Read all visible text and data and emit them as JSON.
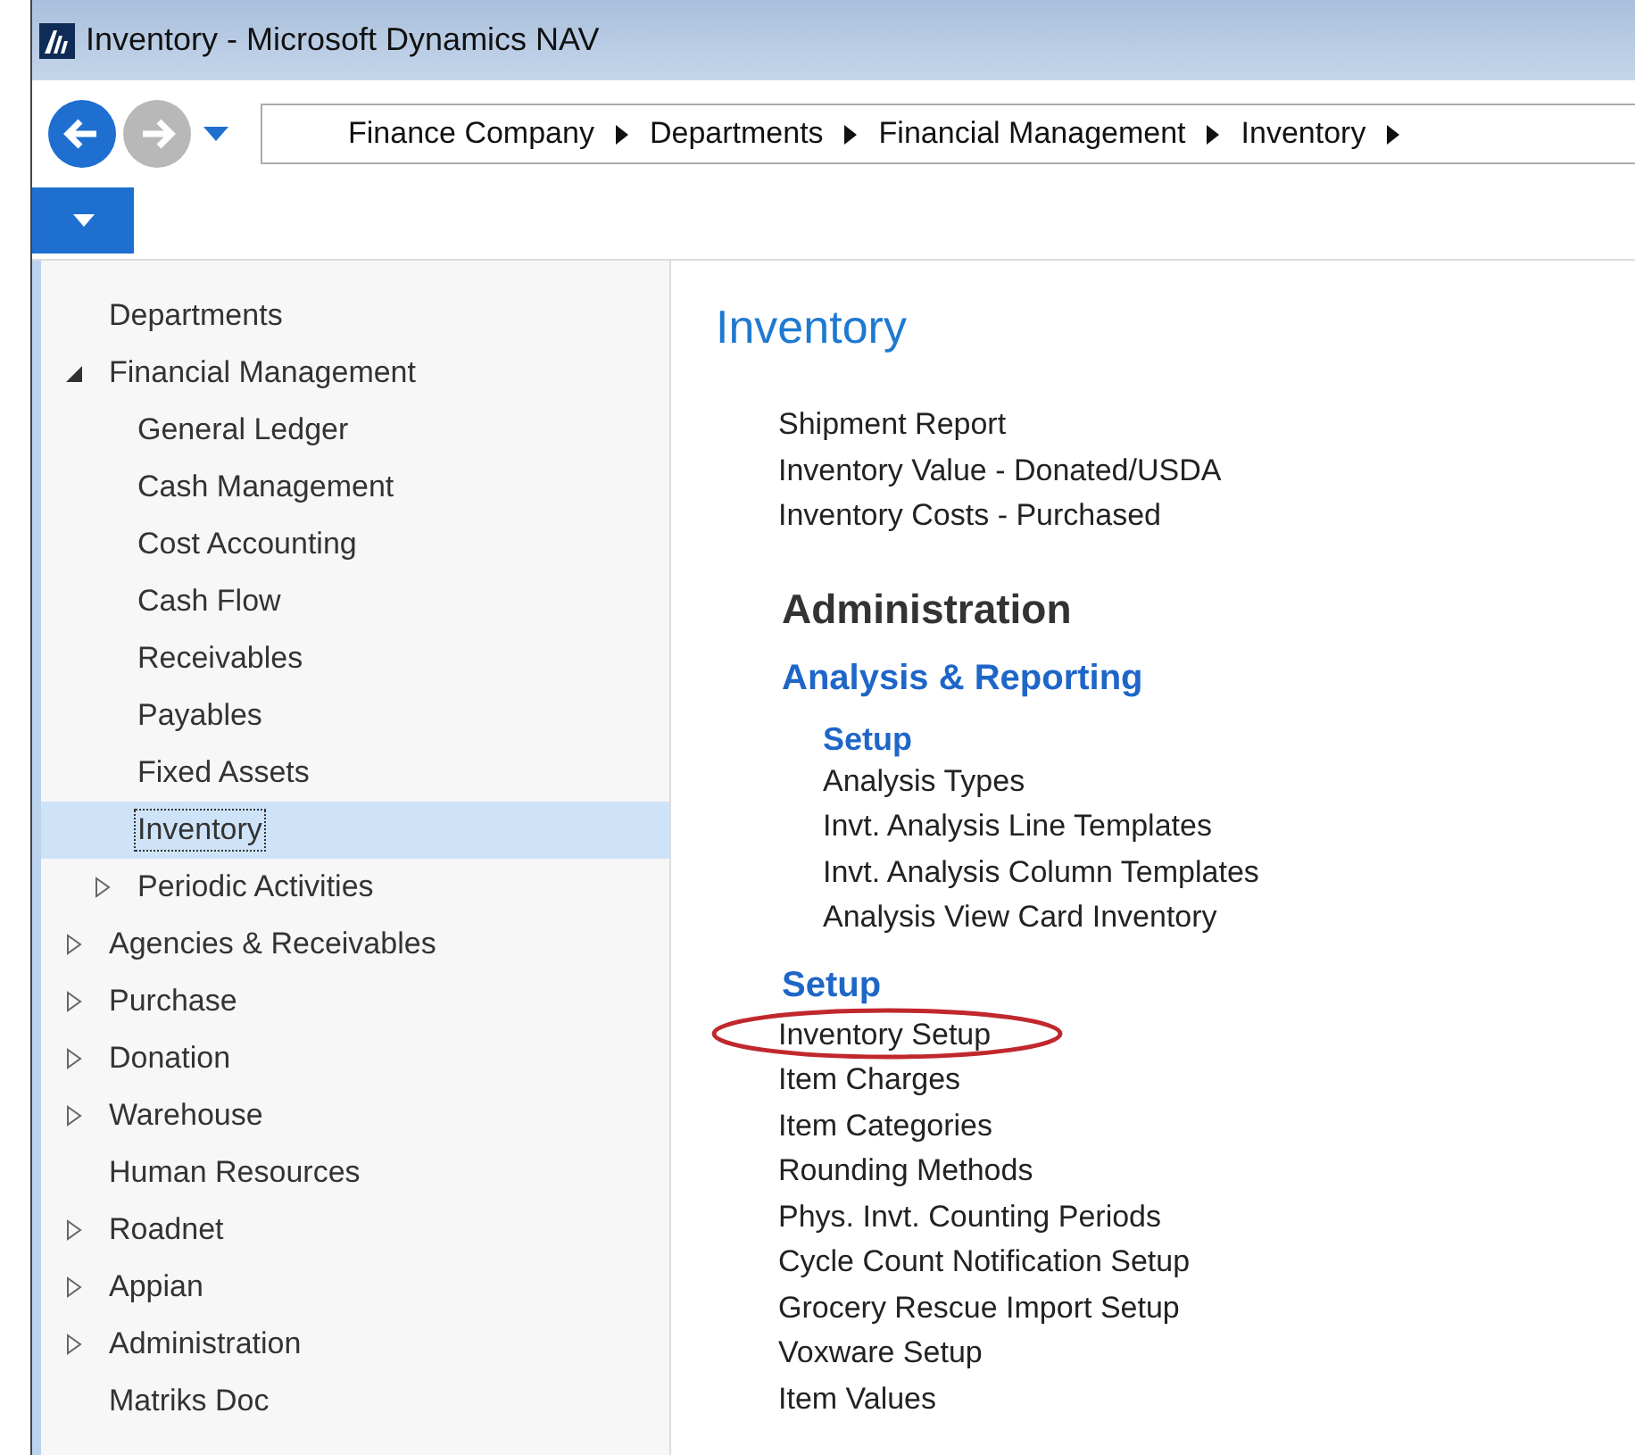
{
  "window": {
    "title": "Inventory - Microsoft Dynamics NAV"
  },
  "navigation": {
    "back_enabled": true,
    "forward_enabled": false,
    "breadcrumb": [
      "Finance Company",
      "Departments",
      "Financial Management",
      "Inventory"
    ]
  },
  "navigation_pane": {
    "items": [
      {
        "label": "Departments",
        "selected": false
      },
      {
        "label": "Financial Management",
        "expanded": true,
        "selected": false,
        "children": [
          {
            "label": "General Ledger",
            "selected": false
          },
          {
            "label": "Cash Management",
            "selected": false
          },
          {
            "label": "Cost Accounting",
            "selected": false
          },
          {
            "label": "Cash Flow",
            "selected": false
          },
          {
            "label": "Receivables",
            "selected": false
          },
          {
            "label": "Payables",
            "selected": false
          },
          {
            "label": "Fixed Assets",
            "selected": false
          },
          {
            "label": "Inventory",
            "selected": true
          },
          {
            "label": "Periodic Activities",
            "expanded": false,
            "selected": false
          }
        ]
      },
      {
        "label": "Agencies & Receivables",
        "expanded": false,
        "selected": false
      },
      {
        "label": "Purchase",
        "expanded": false,
        "selected": false
      },
      {
        "label": "Donation",
        "expanded": false,
        "selected": false
      },
      {
        "label": "Warehouse",
        "expanded": false,
        "selected": false
      },
      {
        "label": "Human Resources",
        "selected": false
      },
      {
        "label": "Roadnet",
        "expanded": false,
        "selected": false
      },
      {
        "label": "Appian",
        "expanded": false,
        "selected": false
      },
      {
        "label": "Administration",
        "expanded": false,
        "selected": false
      },
      {
        "label": "Matriks Doc",
        "selected": false
      }
    ]
  },
  "content": {
    "title": "Inventory",
    "links": [
      "Shipment Report",
      "Inventory Value - Donated/USDA",
      "Inventory Costs - Purchased"
    ],
    "administration": {
      "title": "Administration",
      "groups": [
        {
          "title": "Analysis & Reporting",
          "subgroups": [
            {
              "title": "Setup",
              "links": [
                "Analysis Types",
                "Invt. Analysis Line Templates",
                "Invt. Analysis Column Templates",
                "Analysis View Card Inventory"
              ]
            }
          ]
        },
        {
          "title": "Setup",
          "links": [
            {
              "text": "Inventory Setup",
              "circled": true
            },
            {
              "text": "Item Charges",
              "circled": false
            },
            {
              "text": "Item Categories",
              "circled": false
            },
            {
              "text": "Rounding Methods",
              "circled": false
            },
            {
              "text": "Phys. Invt. Counting Periods",
              "circled": false
            },
            {
              "text": "Cycle Count Notification Setup",
              "circled": false
            },
            {
              "text": "Grocery Rescue Import Setup",
              "circled": false
            },
            {
              "text": "Voxware Setup",
              "circled": false
            },
            {
              "text": "Item Values",
              "circled": false
            }
          ]
        }
      ]
    }
  }
}
